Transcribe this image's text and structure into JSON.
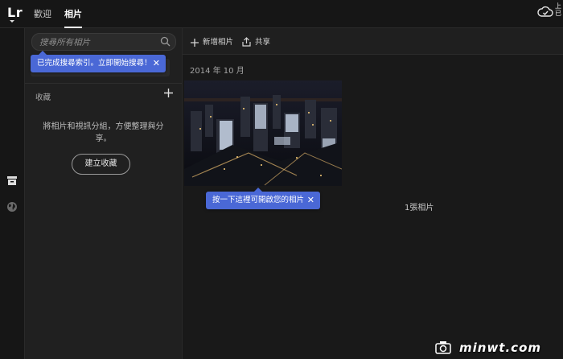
{
  "app": {
    "logo": "Lr"
  },
  "tabs": [
    {
      "label": "歡迎",
      "active": false
    },
    {
      "label": "相片",
      "active": true
    }
  ],
  "cloud_status": {
    "label": "上\n已"
  },
  "sidebar": {
    "search_placeholder": "搜尋所有相片",
    "search_tip": "已完成搜尋索引。立即開始搜尋！",
    "section_title": "收藏",
    "empty_message": "將相片和視訊分組，方便整理與分享。",
    "create_button": "建立收藏"
  },
  "toolbar": {
    "add_photos": "新增相片",
    "share": "共享"
  },
  "main": {
    "date_header": "2014 年 10 月",
    "photo_tip": "按一下這裡可開啟您的相片",
    "photo_count": "1張相片"
  },
  "watermark": {
    "text": "minwt.com"
  },
  "colors": {
    "accent_tip": "#4a68d6",
    "background": "#1a1a1a"
  },
  "icons": [
    "library-icon",
    "globe-icon",
    "search-icon",
    "plus-icon",
    "share-icon",
    "cloud-check-icon",
    "close-icon"
  ]
}
